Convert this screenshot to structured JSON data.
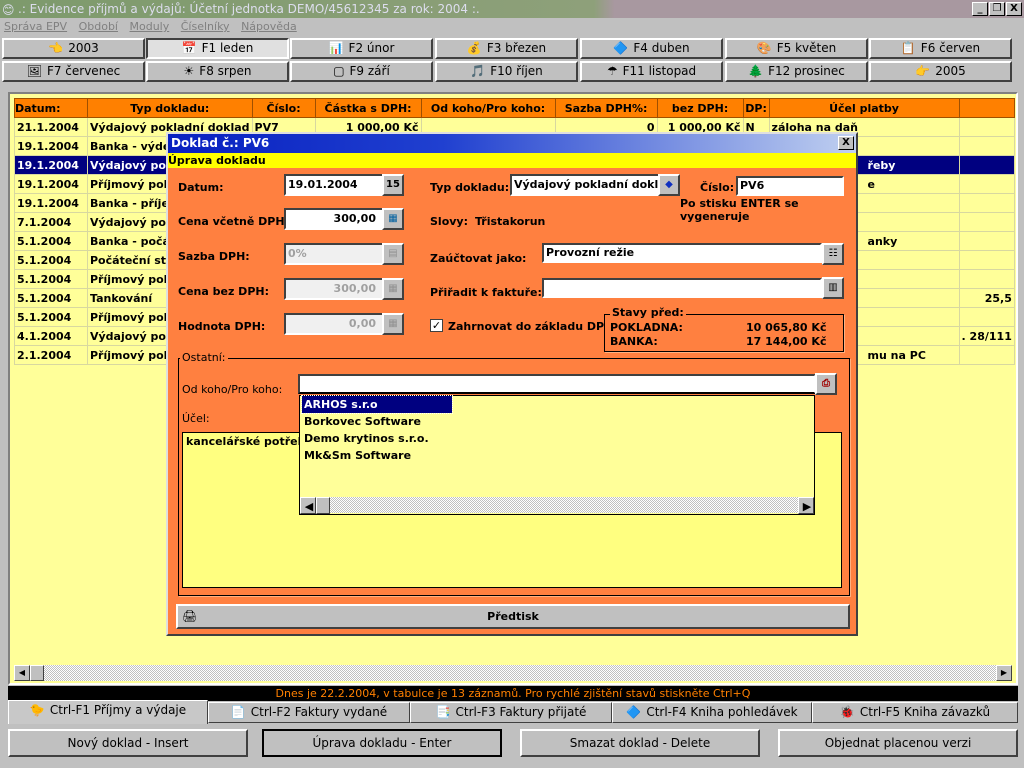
{
  "window": {
    "title": ".: Evidence příjmů a výdajů: Účetní jednotka DEMO/45612345 za rok: 2004 :.",
    "minimize": "_",
    "restore": "❐",
    "close": "X"
  },
  "menu": [
    "Správa EPV",
    "Období",
    "Moduly",
    "Číselníky",
    "Nápověda"
  ],
  "months_row1": [
    {
      "label": "2003",
      "icon": "👈"
    },
    {
      "label": "F1 leden",
      "icon": "📅"
    },
    {
      "label": "F2 únor",
      "icon": "📊"
    },
    {
      "label": "F3 březen",
      "icon": "💰"
    },
    {
      "label": "F4 duben",
      "icon": "🔷"
    },
    {
      "label": "F5 květen",
      "icon": "🎨"
    },
    {
      "label": "F6 červen",
      "icon": "📋"
    }
  ],
  "months_row2": [
    {
      "label": "F7 červenec",
      "icon": "🖼"
    },
    {
      "label": "F8 srpen",
      "icon": "☀"
    },
    {
      "label": "F9 září",
      "icon": "▢"
    },
    {
      "label": "F10 říjen",
      "icon": "🎵"
    },
    {
      "label": "F11 listopad",
      "icon": "☂"
    },
    {
      "label": "F12 prosinec",
      "icon": "🌲"
    },
    {
      "label": "2005",
      "icon": "👉"
    }
  ],
  "table": {
    "columns": [
      "Datum:",
      "Typ dokladu:",
      "Číslo:",
      "Částka s DPH:",
      "Od koho/Pro koho:",
      "Sazba DPH%:",
      "bez DPH:",
      "DP:",
      "Účel platby"
    ],
    "rows": [
      [
        "21.1.2004",
        "Výdajový pokladní doklad",
        "PV7",
        "1 000,00 Kč",
        "",
        "0",
        "1 000,00 Kč",
        "N",
        "záloha na daň",
        ""
      ],
      [
        "19.1.2004",
        "Banka - výdej",
        "",
        "",
        "",
        "",
        "",
        "",
        "",
        ""
      ],
      [
        "19.1.2004",
        "Výdajový pok",
        "",
        "",
        "",
        "",
        "",
        "",
        "řeby",
        ""
      ],
      [
        "19.1.2004",
        "Příjmový pokl",
        "",
        "",
        "",
        "",
        "",
        "",
        "e",
        ""
      ],
      [
        "19.1.2004",
        "Banka - příjer",
        "",
        "",
        "",
        "",
        "",
        "",
        "",
        ""
      ],
      [
        "7.1.2004",
        "Výdajový pok",
        "",
        "",
        "",
        "",
        "",
        "",
        "",
        ""
      ],
      [
        "5.1.2004",
        "Banka - počát",
        "",
        "",
        "",
        "",
        "",
        "",
        "anky",
        ""
      ],
      [
        "5.1.2004",
        "Počáteční sta",
        "",
        "",
        "",
        "",
        "",
        "",
        "",
        ""
      ],
      [
        "5.1.2004",
        "Příjmový pokl",
        "",
        "",
        "",
        "",
        "",
        "",
        "",
        ""
      ],
      [
        "5.1.2004",
        "Tankování",
        "",
        "",
        "",
        "",
        "",
        "",
        "",
        "25,5"
      ],
      [
        "5.1.2004",
        "Příjmový pokl",
        "",
        "",
        "",
        "",
        "",
        "",
        "",
        ""
      ],
      [
        "4.1.2004",
        "Výdajový pok",
        "",
        "",
        "",
        "",
        "",
        "",
        "",
        ". 28/111"
      ],
      [
        "2.1.2004",
        "Příjmový pokl",
        "",
        "",
        "",
        "",
        "",
        "",
        "mu na PC",
        ""
      ]
    ],
    "selected_row": 2
  },
  "status": "Dnes je 22.2.2004, v tabulce  je 13 záznamů. Pro rychlé zjištění stavů stiskněte Ctrl+Q",
  "tabs": [
    {
      "label": "Ctrl-F1 Příjmy a výdaje",
      "icon": "🐤"
    },
    {
      "label": "Ctrl-F2 Faktury vydané",
      "icon": "📄"
    },
    {
      "label": "Ctrl-F3 Faktury přijaté",
      "icon": "📑"
    },
    {
      "label": "Ctrl-F4 Kniha pohledávek",
      "icon": "🔷"
    },
    {
      "label": "Ctrl-F5 Kniha závazků",
      "icon": "🐞"
    }
  ],
  "actions": [
    "Nový doklad - Insert",
    "Úprava dokladu - Enter",
    "Smazat doklad - Delete",
    "Objednat placenou verzi"
  ],
  "dialog": {
    "title": "Doklad č.: PV6",
    "close": "X",
    "subtitle": "Úprava dokladu",
    "datum_label": "Datum:",
    "datum": "19.01.2004",
    "cena_label": "Cena včetně DPH:",
    "cena": "300,00",
    "sazba_label": "Sazba DPH:",
    "sazba": "0%",
    "bez_label": "Cena bez DPH:",
    "bez": "300,00",
    "hodnota_label": "Hodnota DPH:",
    "hodnota": "0,00",
    "typ_label": "Typ dokladu:",
    "typ": "Výdajový pokladní doklad",
    "cislo_label": "Číslo:",
    "cislo": "PV6",
    "cislo_hint": "Po stisku ENTER se vygeneruje",
    "slovy_label": "Slovy:",
    "slovy": "Třistakorun",
    "zauctovat_label": "Zaúčtovat jako:",
    "zauctovat": "Provozní režie",
    "faktura_label": "Přiřadit k faktuře:",
    "faktura": "",
    "zahrnovat_label": "Zahrnovat do základu DP",
    "zahrnovat_checked": true,
    "stavy_label": "Stavy před:",
    "pokladna_label": "POKLADNA:",
    "pokladna": "10 065,80 Kč",
    "banka_label": "BANKA:",
    "banka": "17 144,00 Kč",
    "ostatni_label": "Ostatní:",
    "odkoho_label": "Od koho/Pro koho:",
    "odkoho": "",
    "ucel_label": "Účel:",
    "ucel": "kancelářské potřeby",
    "dropdown_options": [
      "ARHOS s.r.o",
      "Borkovec Software",
      "Demo krytinos s.r.o.",
      "Mk&Sm Software"
    ],
    "dropdown_selected": 0,
    "predtisk": "Předtisk"
  }
}
